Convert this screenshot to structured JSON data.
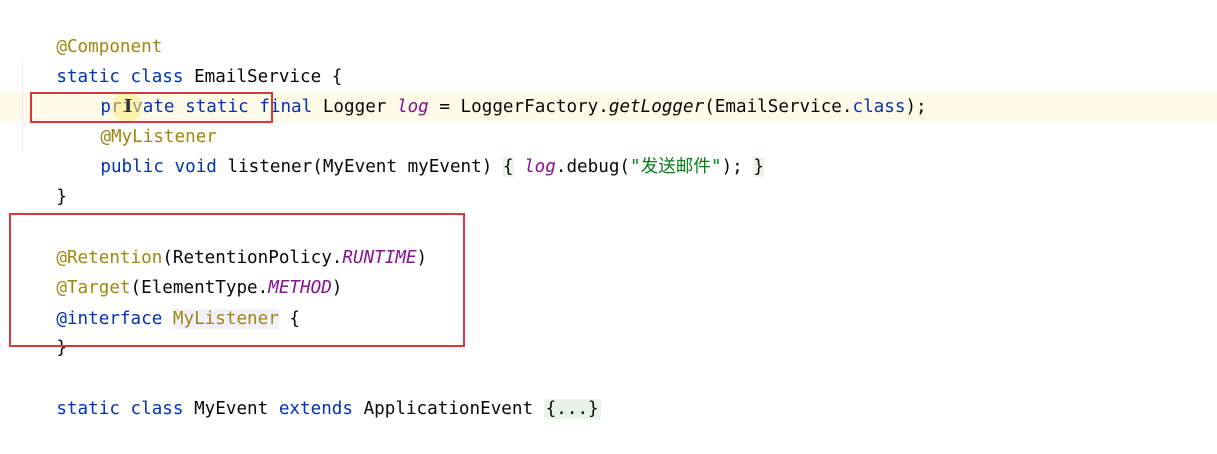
{
  "code": {
    "line1": {
      "anno": "@Component"
    },
    "line2": {
      "kw1": "static",
      "kw2": "class",
      "name": "EmailService",
      "rest": " {"
    },
    "line3": {
      "kw1": "private",
      "kw2": "static",
      "kw3": "final",
      "type": "Logger",
      "field": "log",
      "eq": " = LoggerFactory.",
      "method": "getLogger",
      "arg": "(EmailService.",
      "kw4": "class",
      "end": ");"
    },
    "line4": {
      "anno": "@MyListener"
    },
    "line5": {
      "kw1": "public",
      "kw2": "void",
      "sig": "listener(MyEvent myEvent) ",
      "open": "{",
      "field": "log",
      "call": ".debug(",
      "str": "\"发送邮件\"",
      "close_call": "); ",
      "close": "}"
    },
    "line6": {
      "brace": "}"
    },
    "line8": {
      "anno": "@Retention",
      "open": "(RetentionPolicy.",
      "const": "RUNTIME",
      "close": ")"
    },
    "line9": {
      "anno": "@Target",
      "open": "(ElementType.",
      "const": "METHOD",
      "close": ")"
    },
    "line10": {
      "anno": "@interface",
      "name": "MyListener",
      "rest": " {"
    },
    "line11": {
      "brace": "}"
    },
    "line13": {
      "kw1": "static",
      "kw2": "class",
      "name": "MyEvent",
      "kw3": "extends",
      "base": "ApplicationEvent",
      "fold": "{...}"
    }
  },
  "colors": {
    "keyword": "#0033b3",
    "annotation": "#9e880d",
    "field": "#871094",
    "string": "#067d17",
    "highlight_box": "#d9363e"
  }
}
